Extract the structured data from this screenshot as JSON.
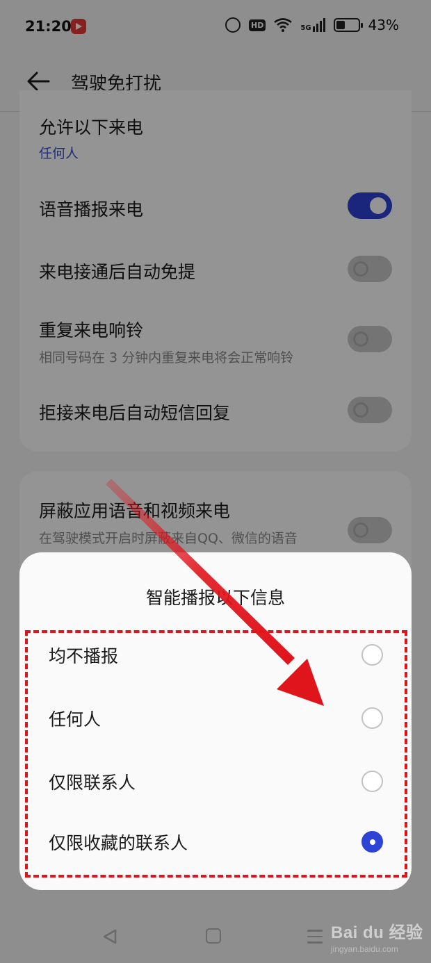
{
  "status_bar": {
    "time": "21:20",
    "hd": "HD",
    "network": "5G",
    "battery_percent": "43%",
    "battery_level": 0.43
  },
  "header": {
    "title": "驾驶免打扰"
  },
  "settings": {
    "allow_calls": {
      "title": "允许以下来电",
      "value": "任何人"
    },
    "voice_announce": {
      "title": "语音播报来电",
      "enabled": true
    },
    "auto_handsfree": {
      "title": "来电接通后自动免提",
      "enabled": false
    },
    "repeat_ring": {
      "title": "重复来电响铃",
      "desc": "相同号码在 3 分钟内重复来电将会正常响铃",
      "enabled": false
    },
    "auto_sms": {
      "title": "拒接来电后自动短信回复",
      "enabled": false
    },
    "block_app_calls": {
      "title": "屏蔽应用语音和视频来电",
      "desc": "在驾驶模式开启时屏蔽来自QQ、微信的语音",
      "enabled": false
    }
  },
  "dialog": {
    "title": "智能播报以下信息",
    "options": [
      {
        "label": "均不播报",
        "selected": false
      },
      {
        "label": "任何人",
        "selected": false
      },
      {
        "label": "仅限联系人",
        "selected": false
      },
      {
        "label": "仅限收藏的联系人",
        "selected": true
      }
    ]
  },
  "colors": {
    "accent": "#2d43d6",
    "annotation": "#e0141b"
  },
  "watermark": {
    "logo": "Bai du 经验",
    "url": "jingyan.baidu.com"
  }
}
